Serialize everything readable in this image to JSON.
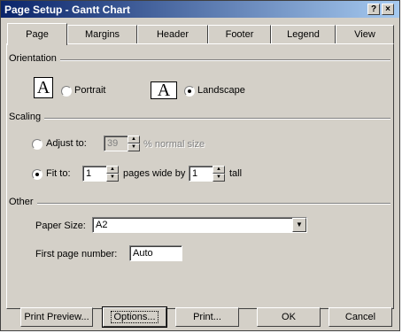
{
  "window": {
    "title": "Page Setup - Gantt Chart",
    "help_button": "?",
    "close_button": "×"
  },
  "tabs": [
    {
      "label": "Page",
      "active": true
    },
    {
      "label": "Margins",
      "active": false
    },
    {
      "label": "Header",
      "active": false
    },
    {
      "label": "Footer",
      "active": false
    },
    {
      "label": "Legend",
      "active": false
    },
    {
      "label": "View",
      "active": false
    }
  ],
  "orientation": {
    "group_label": "Orientation",
    "portrait_glyph": "A",
    "portrait_label": "Portrait",
    "landscape_glyph": "A",
    "landscape_label": "Landscape",
    "selected": "landscape"
  },
  "scaling": {
    "group_label": "Scaling",
    "adjust_label": "Adjust to:",
    "adjust_value": "39",
    "adjust_suffix": "% normal size",
    "fit_label": "Fit to:",
    "fit_wide_value": "1",
    "fit_wide_suffix": "pages wide by",
    "fit_tall_value": "1",
    "fit_tall_suffix": "tall",
    "selected": "fit"
  },
  "other": {
    "group_label": "Other",
    "paper_size_label": "Paper Size:",
    "paper_size_value": "A2",
    "first_page_label": "First page number:",
    "first_page_value": "Auto"
  },
  "buttons": {
    "print_preview": "Print Preview...",
    "options": "Options...",
    "print": "Print...",
    "ok": "OK",
    "cancel": "Cancel"
  },
  "icons": {
    "spin_up": "▲",
    "spin_down": "▼",
    "dropdown_arrow": "▼"
  }
}
